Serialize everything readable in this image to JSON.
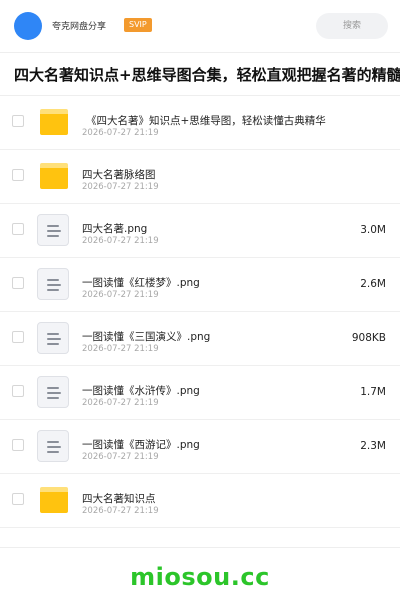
{
  "header": {
    "share_name": "夸克网盘分享",
    "badge": "SVIP",
    "search_label": "搜索"
  },
  "page_title": "四大名著知识点+思维导图合集，轻松直观把握名著的精髓",
  "files": [
    {
      "name": "《四大名著》知识点+思维导图，轻松读懂古典精华",
      "date": "2026-07-27 21:19",
      "size": "",
      "icon": "folder-icon"
    },
    {
      "name": "四大名著脉络图",
      "date": "2026-07-27 21:19",
      "size": "",
      "icon": "folder-icon"
    },
    {
      "name": "四大名著.png",
      "date": "2026-07-27 21:19",
      "size": "3.0M",
      "icon": "image-file-icon"
    },
    {
      "name": "一图读懂《红楼梦》.png",
      "date": "2026-07-27 21:19",
      "size": "2.6M",
      "icon": "image-file-icon"
    },
    {
      "name": "一图读懂《三国演义》.png",
      "date": "2026-07-27 21:19",
      "size": "908KB",
      "icon": "image-file-icon"
    },
    {
      "name": "一图读懂《水浒传》.png",
      "date": "2026-07-27 21:19",
      "size": "1.7M",
      "icon": "image-file-icon"
    },
    {
      "name": "一图读懂《西游记》.png",
      "date": "2026-07-27 21:19",
      "size": "2.3M",
      "icon": "image-file-icon"
    },
    {
      "name": "四大名著知识点",
      "date": "2026-07-27 21:19",
      "size": "",
      "icon": "folder-icon"
    }
  ],
  "watermark": "miosou.cc",
  "colors": {
    "avatar": "#2f86f6",
    "svip_badge": "#f39a2e",
    "folder": "#ffc30f",
    "watermark": "#2cc52a"
  }
}
